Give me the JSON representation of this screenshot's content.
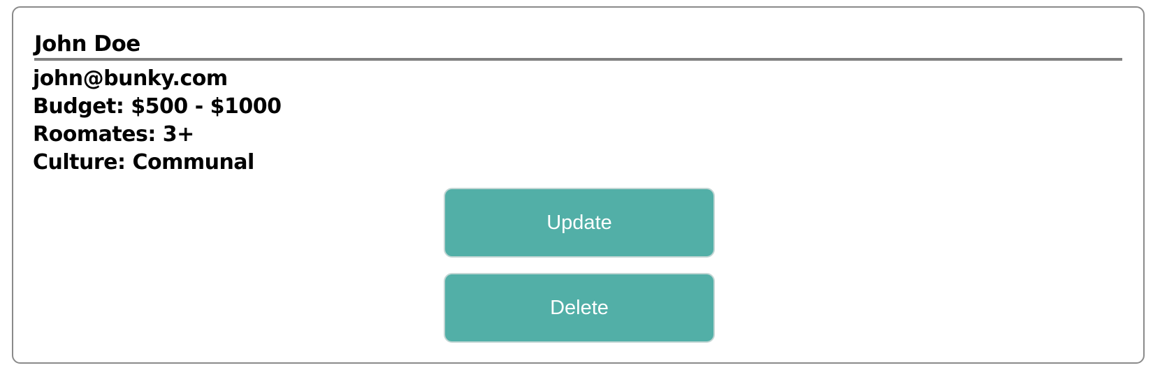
{
  "profile": {
    "name": "John Doe",
    "email": "john@bunky.com",
    "budget": "Budget: $500 - $1000",
    "roommates": "Roomates: 3+",
    "culture": "Culture: Communal"
  },
  "actions": {
    "update_label": "Update",
    "delete_label": "Delete"
  },
  "colors": {
    "button_bg": "#52afa7",
    "button_text": "#ffffff",
    "card_border": "#8a8a8a",
    "divider": "#808080"
  }
}
